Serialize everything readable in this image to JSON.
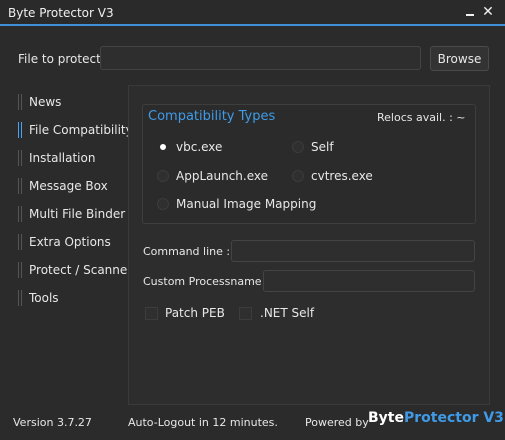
{
  "window": {
    "title": "Byte Protector V3",
    "minimize_glyph": "_",
    "close_glyph": "✕"
  },
  "file": {
    "label": "File to protect:",
    "value": "",
    "placeholder": "",
    "browse_label": "Browse"
  },
  "sidebar": {
    "items": [
      {
        "label": "News"
      },
      {
        "label": "File Compatibility"
      },
      {
        "label": "Installation"
      },
      {
        "label": "Message Box"
      },
      {
        "label": "Multi File Binder"
      },
      {
        "label": "Extra Options"
      },
      {
        "label": "Protect / Scanner"
      },
      {
        "label": "Tools"
      }
    ],
    "active_index": 1
  },
  "compat": {
    "title": "Compatibility Types",
    "relocs": "Relocs avail. : ~",
    "options": [
      {
        "label": "vbc.exe",
        "checked": true
      },
      {
        "label": "Self",
        "checked": false
      },
      {
        "label": "AppLaunch.exe",
        "checked": false
      },
      {
        "label": "cvtres.exe",
        "checked": false
      },
      {
        "label": "Manual Image Mapping",
        "checked": false
      }
    ]
  },
  "command_line": {
    "label": "Command line :",
    "value": ""
  },
  "custom_process": {
    "label": "Custom Processname :",
    "value": ""
  },
  "checks": [
    {
      "label": "Patch PEB",
      "checked": false
    },
    {
      "label": ".NET Self",
      "checked": false
    }
  ],
  "footer": {
    "version": "Version 3.7.27",
    "logout": "Auto-Logout in 12 minutes.",
    "powered": "Powered by",
    "brand_part1": "Byte",
    "brand_part2": "Protector V3"
  },
  "colors": {
    "accent": "#3f9be8",
    "background": "#2b2b2b"
  }
}
